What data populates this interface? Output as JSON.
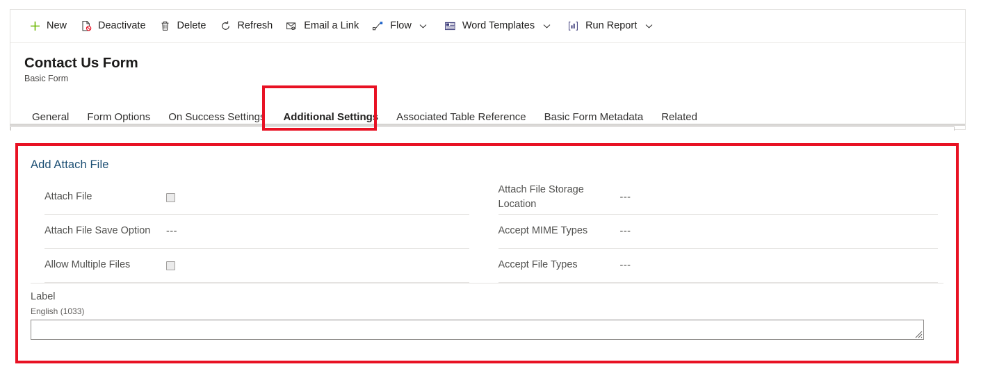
{
  "command_bar": {
    "buttons": [
      {
        "label": "New",
        "icon": "plus-icon",
        "has_caret": false
      },
      {
        "label": "Deactivate",
        "icon": "deactivate-icon",
        "has_caret": false
      },
      {
        "label": "Delete",
        "icon": "trash-icon",
        "has_caret": false
      },
      {
        "label": "Refresh",
        "icon": "refresh-icon",
        "has_caret": false
      },
      {
        "label": "Email a Link",
        "icon": "email-link-icon",
        "has_caret": false
      },
      {
        "label": "Flow",
        "icon": "flow-icon",
        "has_caret": true
      },
      {
        "label": "Word Templates",
        "icon": "word-template-icon",
        "has_caret": true
      },
      {
        "label": "Run Report",
        "icon": "run-report-icon",
        "has_caret": true
      }
    ]
  },
  "record": {
    "title": "Contact Us Form",
    "subtitle": "Basic Form"
  },
  "tabs": [
    {
      "label": "General",
      "selected": false
    },
    {
      "label": "Form Options",
      "selected": false
    },
    {
      "label": "On Success Settings",
      "selected": false
    },
    {
      "label": "Additional Settings",
      "selected": true
    },
    {
      "label": "Associated Table Reference",
      "selected": false
    },
    {
      "label": "Basic Form Metadata",
      "selected": false
    },
    {
      "label": "Related",
      "selected": false
    }
  ],
  "section": {
    "title": "Add Attach File",
    "left_fields": [
      {
        "label": "Attach File",
        "control": "checkbox",
        "value": ""
      },
      {
        "label": "Attach File Save Option",
        "control": "text",
        "value": "---"
      },
      {
        "label": "Allow Multiple Files",
        "control": "checkbox",
        "value": ""
      }
    ],
    "right_fields": [
      {
        "label": "Attach File Storage Location",
        "control": "text",
        "value": "---"
      },
      {
        "label": "Accept MIME Types",
        "control": "text",
        "value": "---"
      },
      {
        "label": "Accept File Types",
        "control": "text",
        "value": "---"
      }
    ],
    "label_block": {
      "heading": "Label",
      "locale": "English (1033)",
      "value": "",
      "placeholder": ""
    }
  },
  "colors": {
    "highlight": "#e81123",
    "tab_underline": "#0f6cbd",
    "section_title": "#1b4e73",
    "new_icon": "#6bb700"
  }
}
